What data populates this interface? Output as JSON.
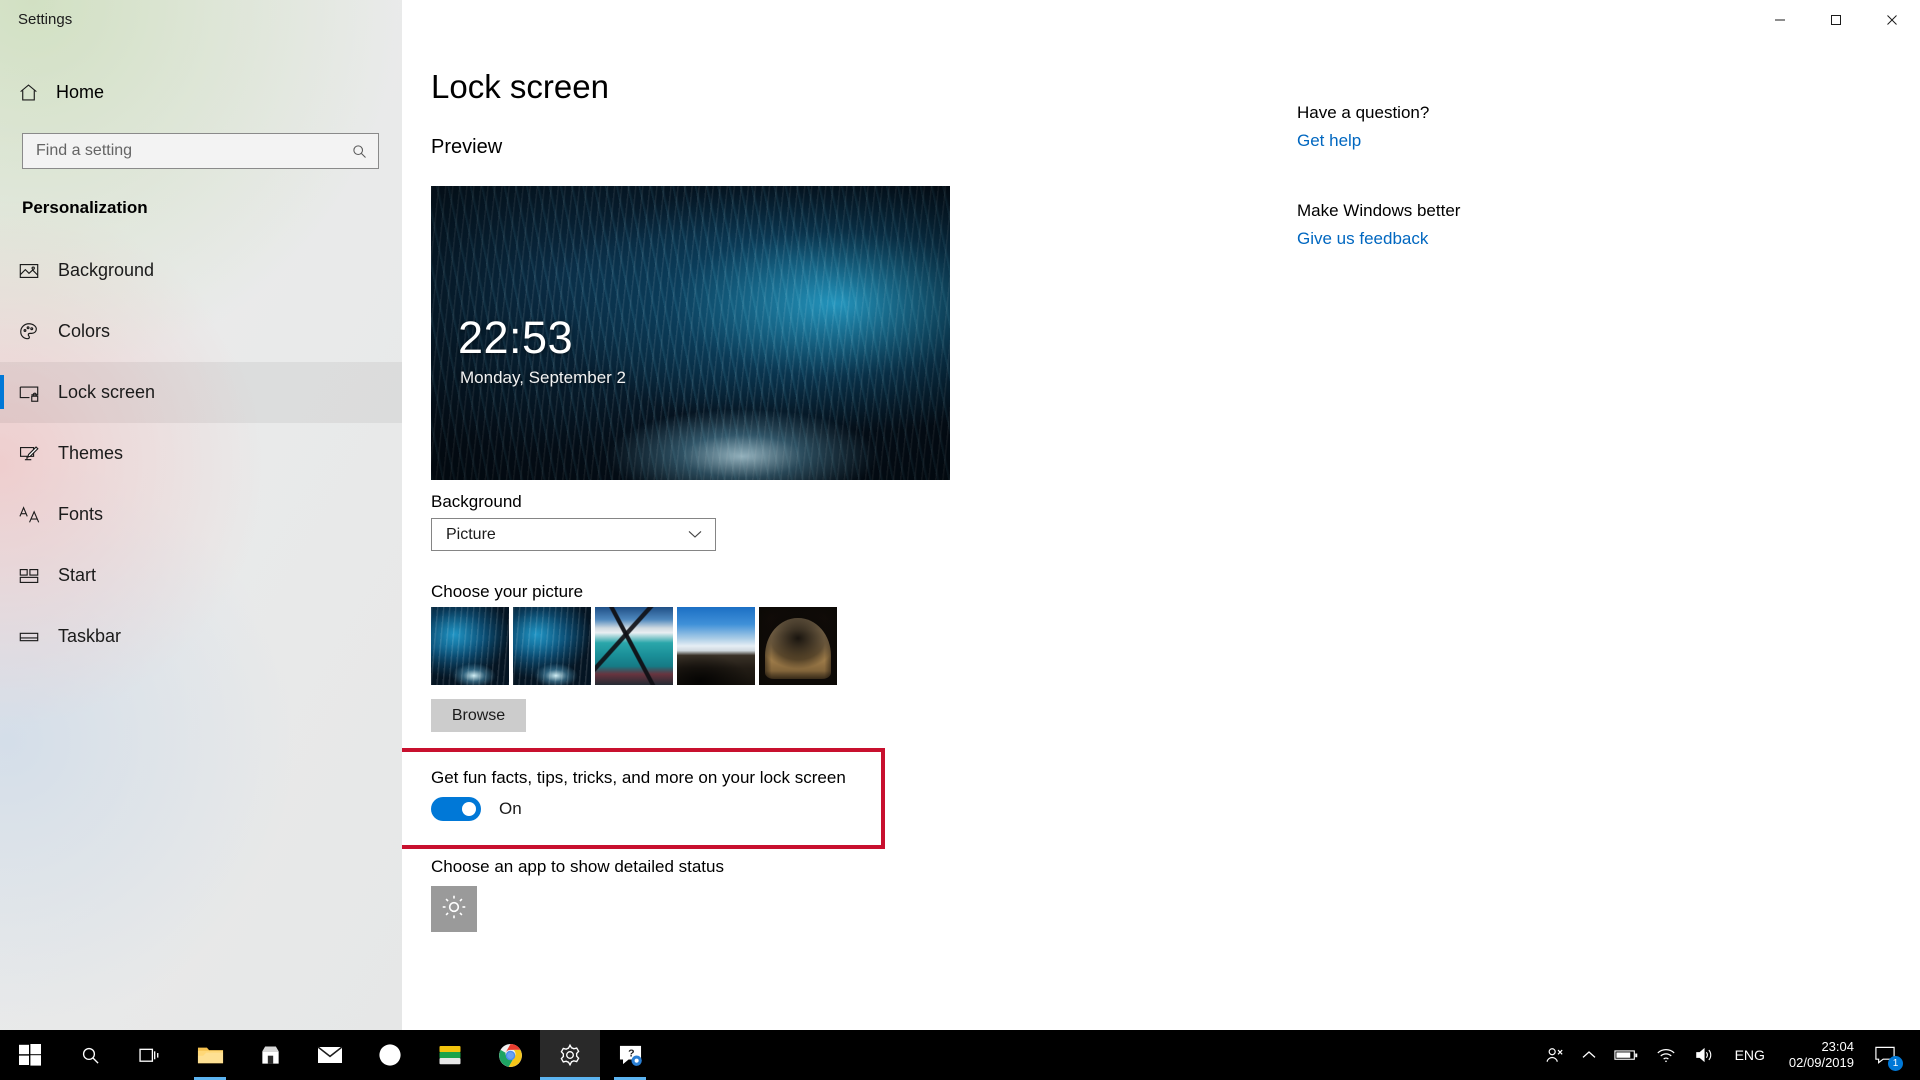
{
  "window": {
    "title": "Settings",
    "minimize_label": "Minimize",
    "maximize_label": "Restore",
    "close_label": "Close"
  },
  "sidebar": {
    "home_label": "Home",
    "home_icon": "home-icon",
    "search": {
      "placeholder": "Find a setting",
      "value": "",
      "icon": "search-icon"
    },
    "section_title": "Personalization",
    "items": [
      {
        "label": "Background",
        "icon": "image-icon",
        "selected": false
      },
      {
        "label": "Colors",
        "icon": "palette-icon",
        "selected": false
      },
      {
        "label": "Lock screen",
        "icon": "lock-screen-icon",
        "selected": true
      },
      {
        "label": "Themes",
        "icon": "theme-brush-icon",
        "selected": false
      },
      {
        "label": "Fonts",
        "icon": "fonts-aa-icon",
        "selected": false
      },
      {
        "label": "Start",
        "icon": "start-tiles-icon",
        "selected": false
      },
      {
        "label": "Taskbar",
        "icon": "taskbar-icon",
        "selected": false
      }
    ]
  },
  "main": {
    "page_title": "Lock screen",
    "preview_heading": "Preview",
    "preview": {
      "clock": "22:53",
      "date": "Monday, September 2"
    },
    "background_label": "Background",
    "background_value": "Picture",
    "background_chevron_icon": "chevron-down-icon",
    "choose_picture_label": "Choose your picture",
    "thumbnails": [
      {
        "name": "ice-cave-1",
        "style": "th-ice"
      },
      {
        "name": "ice-cave-2",
        "style": "th-ice"
      },
      {
        "name": "lagoon",
        "style": "th-lagoon"
      },
      {
        "name": "hillside",
        "style": "th-hill"
      },
      {
        "name": "desert-arch",
        "style": "th-arch"
      }
    ],
    "browse_label": "Browse",
    "fun_facts_label": "Get fun facts, tips, tricks, and more on your lock screen",
    "toggle_state_label": "On",
    "toggle_on": true,
    "detailed_status_label": "Choose an app to show detailed status",
    "detailed_status_app_icon": "weather-sun-icon",
    "highlight_color": "#c8102e",
    "accent_color": "#0078d7"
  },
  "rail": {
    "question_heading": "Have a question?",
    "get_help_link": "Get help",
    "better_heading": "Make Windows better",
    "feedback_link": "Give us feedback",
    "link_color": "#0067c0"
  },
  "taskbar": {
    "items": [
      {
        "name": "start-button",
        "icon": "windows-logo-icon"
      },
      {
        "name": "search-button",
        "icon": "search-icon"
      },
      {
        "name": "task-view-button",
        "icon": "task-view-icon"
      },
      {
        "name": "file-explorer-button",
        "icon": "folder-icon"
      },
      {
        "name": "microsoft-store-button",
        "icon": "store-icon"
      },
      {
        "name": "mail-button",
        "icon": "mail-icon"
      },
      {
        "name": "office-button",
        "icon": "office-icon"
      },
      {
        "name": "sticky-notes-button",
        "icon": "notes-icon"
      },
      {
        "name": "chrome-button",
        "icon": "chrome-icon"
      },
      {
        "name": "settings-button",
        "icon": "gear-icon"
      },
      {
        "name": "feedback-hub-button",
        "icon": "feedback-hub-icon"
      }
    ],
    "tray": {
      "people_icon": "people-icon",
      "chevron_up_icon": "chevron-up-icon",
      "battery_icon": "battery-icon",
      "network_icon": "wifi-icon",
      "volume_icon": "volume-icon",
      "language": "ENG",
      "time": "23:04",
      "date": "02/09/2019",
      "notification_icon": "notification-icon",
      "notification_count": "1"
    }
  }
}
